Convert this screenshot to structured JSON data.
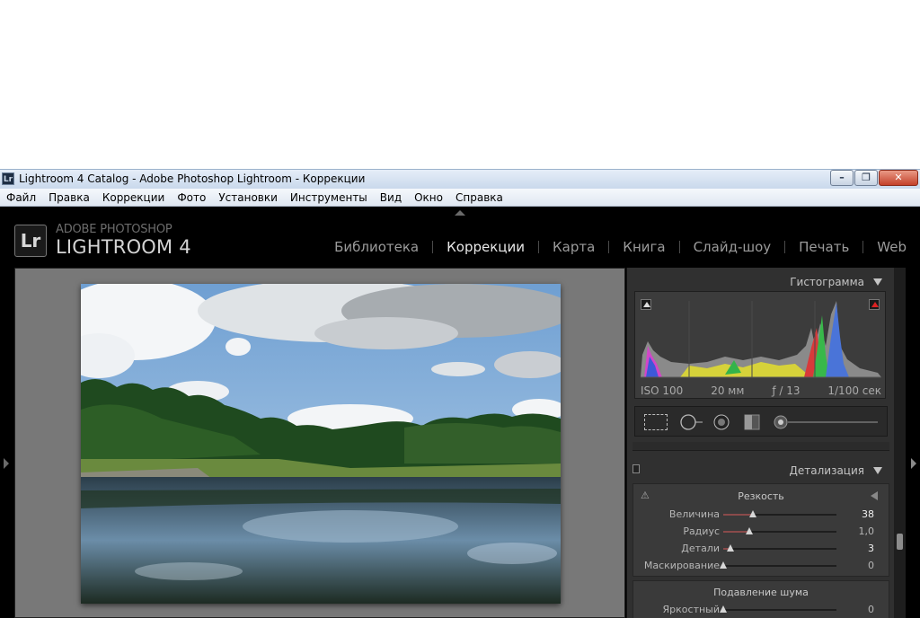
{
  "window": {
    "title": "Lightroom 4 Catalog - Adobe Photoshop Lightroom - Коррекции",
    "icon_text": "Lr",
    "minimize": "–",
    "maximize": "❐",
    "close": "✕"
  },
  "menu": [
    "Файл",
    "Правка",
    "Коррекции",
    "Фото",
    "Установки",
    "Инструменты",
    "Вид",
    "Окно",
    "Справка"
  ],
  "brand": {
    "logo": "Lr",
    "top": "ADOBE PHOTOSHOP",
    "main": "LIGHTROOM 4"
  },
  "modules": [
    {
      "label": "Библиотека",
      "active": false
    },
    {
      "label": "Коррекции",
      "active": true
    },
    {
      "label": "Карта",
      "active": false
    },
    {
      "label": "Книга",
      "active": false
    },
    {
      "label": "Слайд-шоу",
      "active": false
    },
    {
      "label": "Печать",
      "active": false
    },
    {
      "label": "Web",
      "active": false
    }
  ],
  "histogram": {
    "title": "Гистограмма",
    "iso": "ISO 100",
    "focal": "20 мм",
    "aperture": "ƒ / 13",
    "shutter": "1/100 сек"
  },
  "detail": {
    "title": "Детализация",
    "sharpening": {
      "title": "Резкость",
      "rows": [
        {
          "label": "Величина",
          "value": "38",
          "level": 0.26,
          "hi": true
        },
        {
          "label": "Радиус",
          "value": "1,0",
          "level": 0.23,
          "hi": false
        },
        {
          "label": "Детали",
          "value": "3",
          "level": 0.06,
          "hi": true
        },
        {
          "label": "Маскирование",
          "value": "0",
          "level": 0.0,
          "hi": false
        }
      ]
    },
    "noise": {
      "title": "Подавление шума",
      "rows": [
        {
          "label": "Яркостный",
          "value": "0",
          "level": 0.0,
          "hi": false
        }
      ]
    }
  },
  "colors": {
    "accent_fill": "#8a4a4a",
    "panel_bg": "#303030",
    "canvas_bg": "#787878"
  }
}
